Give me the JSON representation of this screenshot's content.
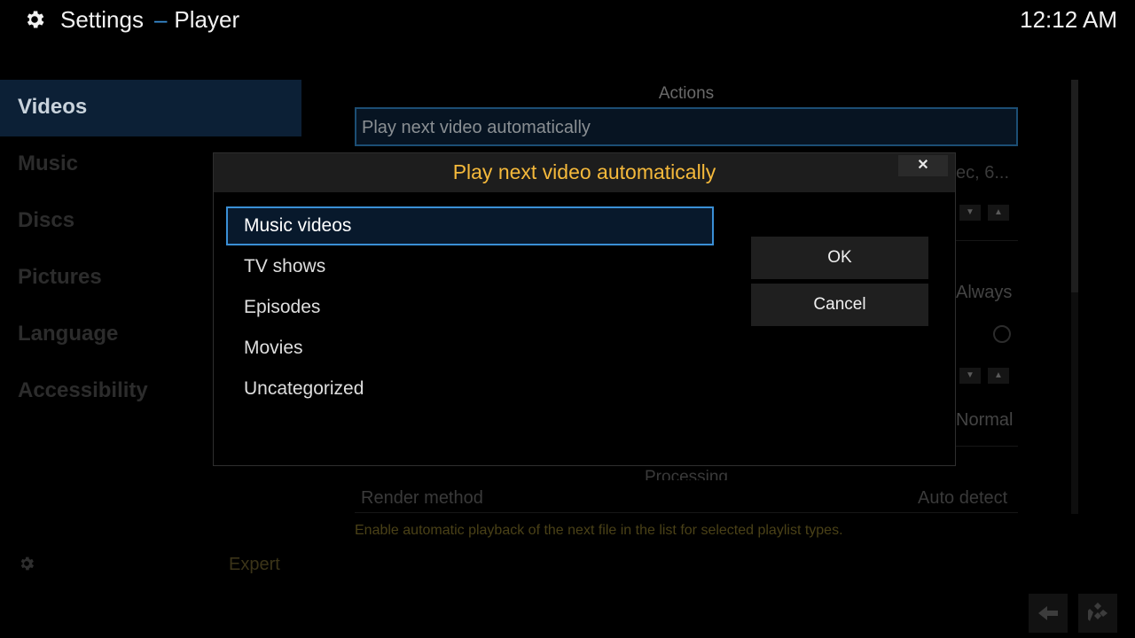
{
  "header": {
    "section": "Settings",
    "separator": "–",
    "page": "Player",
    "time": "12:12 AM",
    "icon": "gear-icon"
  },
  "sidebar": {
    "items": [
      {
        "label": "Videos",
        "active": true
      },
      {
        "label": "Music"
      },
      {
        "label": "Discs"
      },
      {
        "label": "Pictures"
      },
      {
        "label": "Language"
      },
      {
        "label": "Accessibility"
      }
    ],
    "level": "Expert"
  },
  "content": {
    "section_actions": "Actions",
    "focused_row_label": "Play next video automatically",
    "partial_value_1": "ec, 6...",
    "partial_value_always": "Always",
    "partial_value_normal": "Normal",
    "section_processing": "Processing",
    "render_method_label": "Render method",
    "render_method_value": "Auto detect",
    "hint": "Enable automatic playback of the next file in the list for selected playlist types."
  },
  "dialog": {
    "title": "Play next video automatically",
    "close_label": "✕",
    "options": [
      {
        "label": "Music videos",
        "selected": true
      },
      {
        "label": "TV shows"
      },
      {
        "label": "Episodes"
      },
      {
        "label": "Movies"
      },
      {
        "label": "Uncategorized"
      }
    ],
    "ok_label": "OK",
    "cancel_label": "Cancel"
  },
  "colors": {
    "accent": "#3a8fd6",
    "dialog_title": "#f5b93b",
    "selected_bg": "#08192c"
  }
}
